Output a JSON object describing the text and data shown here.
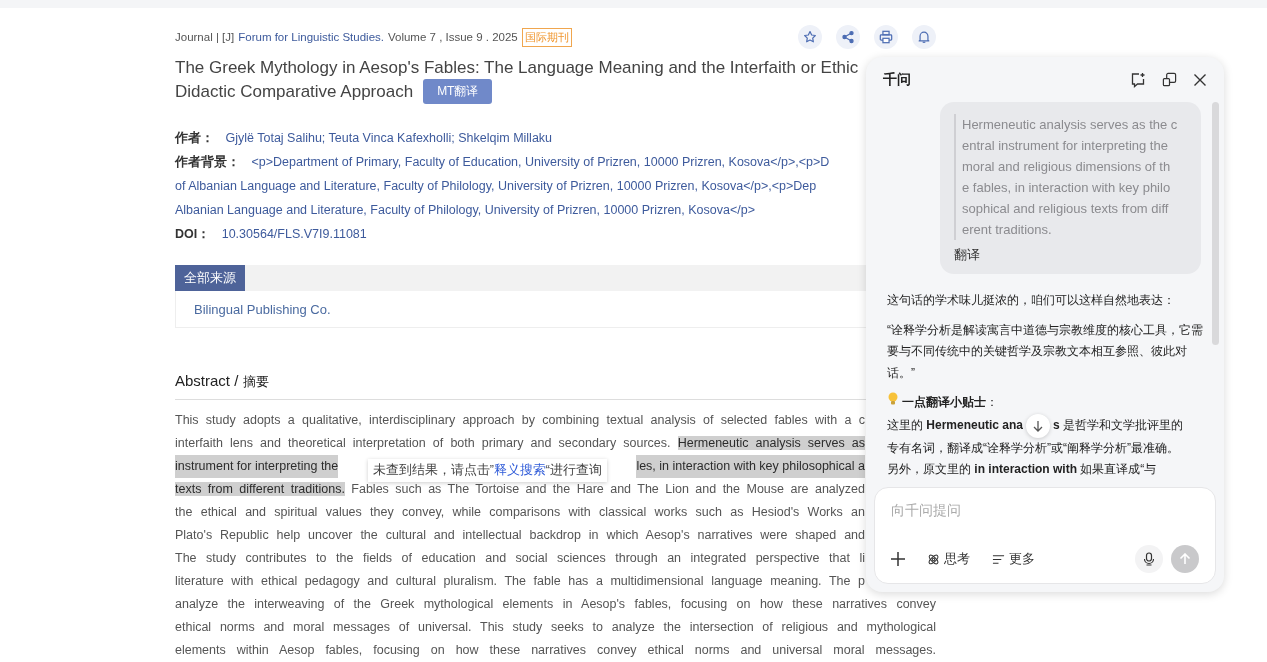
{
  "journal_line": {
    "prefix": "Journal | [J]",
    "journal": "Forum for Linguistic Studies.",
    "issue": "Volume 7 , Issue 9 . 2025",
    "badge": "国际期刊"
  },
  "toolbar": [
    {
      "kind": "star"
    },
    {
      "kind": "share"
    },
    {
      "kind": "print"
    },
    {
      "kind": "bell"
    }
  ],
  "title_lines": [
    "The Greek Mythology in Aesop's Fables: The Language Meaning and the Interfaith or Ethic",
    "Didactic Comparative Approach"
  ],
  "translate_button": "MT翻译",
  "meta": [
    {
      "label": "作者：",
      "lines": [
        "Gjylë Totaj Salihu; Teuta Vinca Kafexholli; Shkelqim Millaku"
      ]
    },
    {
      "label": "作者背景：",
      "lines": [
        "<p>Department of Primary, Faculty of Education, University of Prizren, 10000 Prizren, Kosova</p>,<p>D",
        "of Albanian Language and Literature, Faculty of Philology, University of Prizren, 10000 Prizren, Kosova</p>,<p>Dep",
        "Albanian Language and Literature, Faculty of Philology, University of Prizren, 10000 Prizren, Kosova</p>"
      ]
    },
    {
      "label": "DOI：",
      "lines": [
        "10.30564/FLS.V7I9.11081"
      ]
    }
  ],
  "sources": {
    "tabs": [
      {
        "label": "全部来源",
        "selected": true
      }
    ],
    "items": [
      "Bilingual Publishing Co."
    ]
  },
  "abstract": {
    "heading": "Abstract /",
    "heading_zh": "摘要",
    "lines": [
      [
        {
          "kind": "text",
          "text": "This study adopts a qualitative, interdisciplinary approach by combining textual analysis of selected fables with a c"
        }
      ],
      [
        {
          "kind": "text",
          "text": "interfaith lens and theoretical interpretation of both primary and secondary sources."
        },
        {
          "kind": "highlight",
          "text": "Hermeneutic analysis serves as"
        }
      ],
      [
        {
          "kind": "highlight",
          "text": "instrument for interpreting the"
        },
        {
          "kind": "tooltip",
          "before": "未查到结果，请点击”",
          "link": "释义搜索",
          "after": "“进行查询"
        },
        {
          "kind": "highlight",
          "text": "les, in interaction with key philosophical a"
        }
      ],
      [
        {
          "kind": "highlight",
          "text": "texts from different traditions."
        },
        {
          "kind": "text",
          "text": "Fables such as The Tortoise and the Hare and The Lion and the Mouse are analyzed"
        }
      ],
      [
        {
          "kind": "text",
          "text": "the ethical and spiritual values they convey, while comparisons with classical works such as Hesiod's Works an"
        }
      ],
      [
        {
          "kind": "text",
          "text": "Plato's Republic help uncover the cultural and intellectual backdrop in which Aesop's narratives were shaped and"
        }
      ],
      [
        {
          "kind": "text",
          "text": "The study contributes to the fields of education and social sciences through an integrated perspective that li"
        }
      ],
      [
        {
          "kind": "text",
          "text": "literature with ethical pedagogy and cultural pluralism. The fable has a multidimensional language meaning. The p"
        }
      ],
      [
        {
          "kind": "text",
          "text": "analyze the interweaving of the Greek mythological elements in Aesop's fables, focusing on how these narratives convey"
        }
      ],
      [
        {
          "kind": "text",
          "text": "ethical norms and moral messages of universal. This study seeks to analyze the intersection of religious and mythological"
        }
      ],
      [
        {
          "kind": "text",
          "text": "elements within Aesop fables, focusing on how these narratives convey ethical norms and universal moral messages."
        }
      ]
    ]
  },
  "assistant_panel": {
    "title": "千问",
    "header_icons": [
      {
        "kind": "new-chat"
      },
      {
        "kind": "popout"
      },
      {
        "kind": "close"
      }
    ],
    "quote_lines": [
      "Hermeneutic analysis serves as the c",
      "entral instrument for interpreting the",
      "moral and religious dimensions of th",
      "e fables, in interaction with key philo",
      "sophical and religious texts from diff",
      "erent traditions."
    ],
    "quote_action": "翻译",
    "answer": [
      {
        "kind": "para",
        "text": "这句话的学术味儿挺浓的，咱们可以这样自然地表达："
      },
      {
        "kind": "para",
        "text": "“诠释学分析是解读寓言中道德与宗教维度的核心工具，它需要与不同传统中的关键哲学及宗教文本相互参照、彼此对话。”"
      },
      {
        "kind": "tip",
        "text": "**一点翻译小贴士**："
      },
      {
        "kind": "split",
        "before": "这里的 **Hermeneutic ana**",
        "after": "**s** 是哲学和文学批评里的"
      },
      {
        "kind": "line",
        "text": "专有名词，翻译成“诠释学分析”或“阐释学分析”最准确。"
      },
      {
        "kind": "para",
        "text": "另外，原文里的 **in interaction with** 如果直译成“与"
      }
    ],
    "input": {
      "placeholder": "向千问提问"
    },
    "tools": [
      {
        "kind": "add"
      },
      {
        "kind": "think",
        "label": "思考"
      },
      {
        "kind": "more",
        "label": "更多"
      }
    ]
  }
}
